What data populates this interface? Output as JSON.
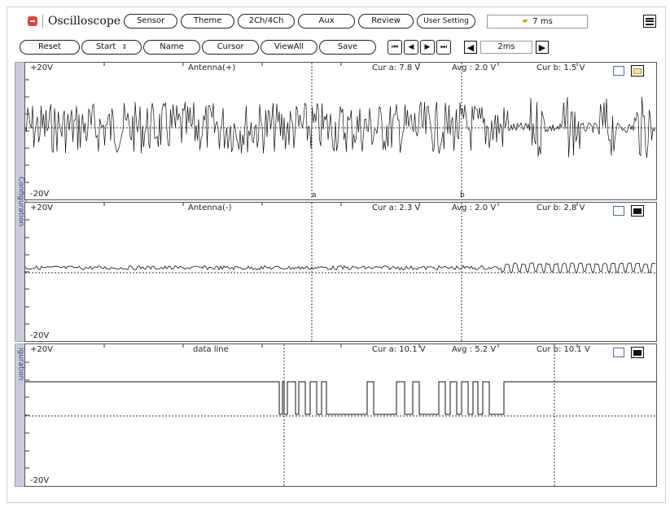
{
  "app": {
    "title": "Oscilloscope"
  },
  "toolbar1": {
    "sensor": "Sensor",
    "theme": "Theme",
    "channels": "2Ch/4Ch",
    "aux": "Aux",
    "review": "Review",
    "user_setting": "User Setting",
    "time_display": "7 ms"
  },
  "toolbar2": {
    "reset": "Reset",
    "start": "Start",
    "name": "Name",
    "cursor": "Cursor",
    "viewall": "ViewAll",
    "save": "Save",
    "timebase": "2ms"
  },
  "sidebar": {
    "tab1": "Configuration",
    "tab2": "iguration"
  },
  "channels": [
    {
      "top": "+20V",
      "bottom": "-20V",
      "name": "Antenna(+)",
      "cur_a": "Cur a: 7.8 V",
      "avg": "Avg  : 2.0 V",
      "cur_b": "Cur b: 1.5 V",
      "marker_a": "a",
      "marker_b": "b"
    },
    {
      "top": "+20V",
      "bottom": "-20V",
      "name": "Antenna(-)",
      "cur_a": "Cur a: 2.3 V",
      "avg": "Avg  : 2.0 V",
      "cur_b": "Cur b: 2.8 V"
    },
    {
      "top": "+20V",
      "bottom": "-20V",
      "name": "data line",
      "cur_a": "Cur a: 10.1 V",
      "avg": "Avg  : 5.2 V",
      "cur_b": "Cur b: 10.1 V"
    }
  ],
  "colors": {
    "accent": "#e0443a",
    "sidebar": "#c9ccd8",
    "trace": "#111111"
  }
}
